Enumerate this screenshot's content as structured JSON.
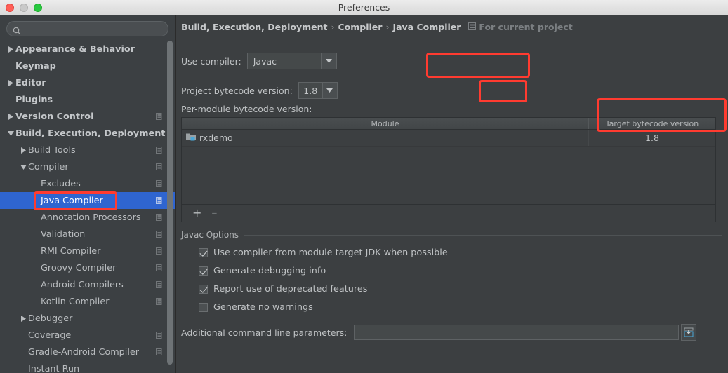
{
  "window": {
    "title": "Preferences",
    "traffic_lights": [
      "close-button",
      "minimize-button",
      "zoom-button"
    ]
  },
  "sidebar": {
    "search": {
      "value": "",
      "placeholder": "",
      "icon": "search-icon"
    },
    "items": [
      {
        "label": "Appearance & Behavior",
        "arrow": "right",
        "indent": 0,
        "bold": true,
        "module_icon": false,
        "selected": false
      },
      {
        "label": "Keymap",
        "arrow": "none",
        "indent": 0,
        "bold": true,
        "module_icon": false,
        "selected": false
      },
      {
        "label": "Editor",
        "arrow": "right",
        "indent": 0,
        "bold": true,
        "module_icon": false,
        "selected": false
      },
      {
        "label": "Plugins",
        "arrow": "none",
        "indent": 0,
        "bold": true,
        "module_icon": false,
        "selected": false
      },
      {
        "label": "Version Control",
        "arrow": "right",
        "indent": 0,
        "bold": true,
        "module_icon": true,
        "selected": false
      },
      {
        "label": "Build, Execution, Deployment",
        "arrow": "down",
        "indent": 0,
        "bold": true,
        "module_icon": false,
        "selected": false
      },
      {
        "label": "Build Tools",
        "arrow": "right",
        "indent": 1,
        "bold": false,
        "module_icon": true,
        "selected": false
      },
      {
        "label": "Compiler",
        "arrow": "down",
        "indent": 1,
        "bold": false,
        "module_icon": true,
        "selected": false
      },
      {
        "label": "Excludes",
        "arrow": "none",
        "indent": 2,
        "bold": false,
        "module_icon": true,
        "selected": false
      },
      {
        "label": "Java Compiler",
        "arrow": "none",
        "indent": 2,
        "bold": false,
        "module_icon": true,
        "selected": true
      },
      {
        "label": "Annotation Processors",
        "arrow": "none",
        "indent": 2,
        "bold": false,
        "module_icon": true,
        "selected": false
      },
      {
        "label": "Validation",
        "arrow": "none",
        "indent": 2,
        "bold": false,
        "module_icon": true,
        "selected": false
      },
      {
        "label": "RMI Compiler",
        "arrow": "none",
        "indent": 2,
        "bold": false,
        "module_icon": true,
        "selected": false
      },
      {
        "label": "Groovy Compiler",
        "arrow": "none",
        "indent": 2,
        "bold": false,
        "module_icon": true,
        "selected": false
      },
      {
        "label": "Android Compilers",
        "arrow": "none",
        "indent": 2,
        "bold": false,
        "module_icon": true,
        "selected": false
      },
      {
        "label": "Kotlin Compiler",
        "arrow": "none",
        "indent": 2,
        "bold": false,
        "module_icon": true,
        "selected": false
      },
      {
        "label": "Debugger",
        "arrow": "right",
        "indent": 1,
        "bold": false,
        "module_icon": false,
        "selected": false
      },
      {
        "label": "Coverage",
        "arrow": "none",
        "indent": 1,
        "bold": false,
        "module_icon": true,
        "selected": false
      },
      {
        "label": "Gradle-Android Compiler",
        "arrow": "none",
        "indent": 1,
        "bold": false,
        "module_icon": true,
        "selected": false
      },
      {
        "label": "Instant Run",
        "arrow": "none",
        "indent": 1,
        "bold": false,
        "module_icon": false,
        "selected": false
      }
    ]
  },
  "content": {
    "breadcrumb": {
      "parts": [
        "Build, Execution, Deployment",
        "Compiler",
        "Java Compiler"
      ],
      "separator": "›",
      "scope_label": "For current project",
      "scope_icon": "module-scope-icon"
    },
    "use_compiler": {
      "label": "Use compiler:",
      "value": "Javac"
    },
    "project_bytecode": {
      "label": "Project bytecode version:",
      "value": "1.8"
    },
    "per_module": {
      "label": "Per-module bytecode version:",
      "columns": [
        "Module",
        "Target bytecode version"
      ],
      "rows": [
        {
          "module": "rxdemo",
          "module_icon": "module-folder-icon",
          "target": "1.8"
        }
      ],
      "toolbar": {
        "add": "+",
        "remove": "–"
      }
    },
    "javac_options": {
      "title": "Javac Options",
      "checkboxes": [
        {
          "label": "Use compiler from module target JDK when possible",
          "checked": true
        },
        {
          "label": "Generate debugging info",
          "checked": true
        },
        {
          "label": "Report use of deprecated features",
          "checked": true
        },
        {
          "label": "Generate no warnings",
          "checked": false
        }
      ],
      "params": {
        "label": "Additional command line parameters:",
        "value": "",
        "placeholder": "",
        "browse_icon": "expand-editor-icon"
      }
    }
  },
  "annotations": {
    "highlight_color": "#ff3b30",
    "boxes": [
      "java-compiler-sidebar-item",
      "use-compiler-dropdown",
      "project-bytecode-dropdown",
      "target-bytecode-column"
    ]
  }
}
